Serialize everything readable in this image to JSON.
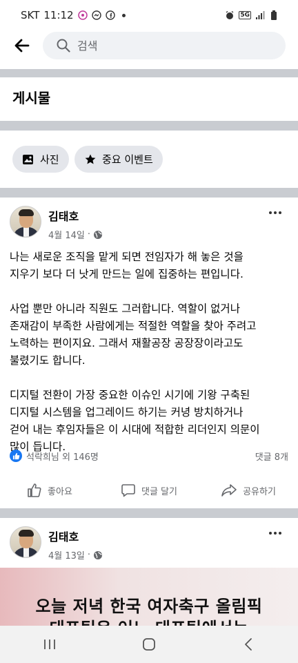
{
  "status_bar": {
    "carrier": "SKT",
    "time": "11:12",
    "signal_label": "5G"
  },
  "search": {
    "placeholder": "검색"
  },
  "section": {
    "title": "게시물"
  },
  "filters": {
    "photos_label": "사진",
    "events_label": "중요 이벤트"
  },
  "post1": {
    "author": "김태호",
    "date": "4월 14일",
    "separator": "·",
    "paragraphs": [
      "나는 새로운 조직을 맡게 되면 전임자가 해 놓은 것을\n지우기 보다 더 낫게 만드는 일에 집중하는 편입니다.",
      "사업 뿐만 아니라 직원도 그러합니다. 역할이 없거나\n존재감이 부족한 사람에게는 적절한 역할을 찾아 주려고\n노력하는 편이지요. 그래서 재활공장 공장장이라고도\n불렸기도 합니다.",
      "디지털 전환이 가장 중요한 이슈인 시기에 기왕 구축된\n디지털 시스템을 업그레이드 하기는 커녕 방치하거나\n걷어 내는 후임자들은 이 시대에 적합한 리더인지 의문이\n많이 듭니다."
    ],
    "reactions_text": "석락희님 외 146명",
    "comments_text": "댓글 8개"
  },
  "actions": {
    "like_label": "좋아요",
    "comment_label": "댓글 달기",
    "share_label": "공유하기"
  },
  "post2": {
    "author": "김태호",
    "date": "4월 13일",
    "separator": "·",
    "headline_line1": "오늘 저녁 한국 여자축구 올림픽",
    "headline_line2": "대표팀은 어느 대표팀에서는"
  },
  "colors": {
    "accent": "#1877f2",
    "divider": "#c9ccd1",
    "chip_bg": "#e4e6eb",
    "search_bg": "#f0f2f5",
    "muted_text": "#65676b"
  },
  "icons": {
    "back": "arrow-left-icon",
    "search": "search-icon",
    "photos": "photo-icon",
    "events": "star-icon",
    "privacy": "globe-icon",
    "more": "more-horizontal-icon",
    "like_badge": "thumbs-up-icon",
    "like": "like-icon",
    "comment": "comment-icon",
    "share": "share-icon"
  }
}
